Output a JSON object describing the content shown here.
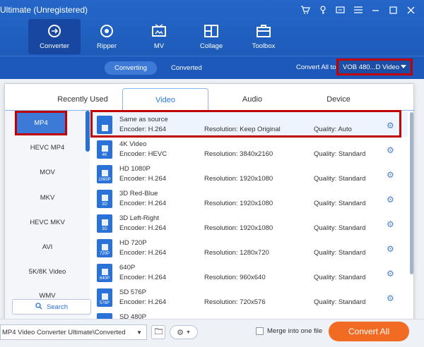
{
  "window": {
    "title": "Ultimate (Unregistered)"
  },
  "nav": [
    {
      "label": "Converter",
      "icon": "converter-icon"
    },
    {
      "label": "Ripper",
      "icon": "ripper-icon"
    },
    {
      "label": "MV",
      "icon": "mv-icon"
    },
    {
      "label": "Collage",
      "icon": "collage-icon"
    },
    {
      "label": "Toolbox",
      "icon": "toolbox-icon"
    }
  ],
  "subbar": {
    "converting": "Converting",
    "converted": "Converted",
    "convert_all_to": "Convert All to",
    "format_value": "VOB 480...D Video"
  },
  "panel": {
    "tabs": [
      "Recently Used",
      "Video",
      "Audio",
      "Device"
    ],
    "formats": [
      "MP4",
      "HEVC MP4",
      "MOV",
      "MKV",
      "HEVC MKV",
      "AVI",
      "5K/8K Video",
      "WMV"
    ],
    "search": "Search",
    "presets": [
      {
        "name": "Same as source",
        "encoder": "Encoder: H.264",
        "resolution": "Resolution: Keep Original",
        "quality": "Quality: Auto",
        "badge": ""
      },
      {
        "name": "4K Video",
        "encoder": "Encoder: HEVC",
        "resolution": "Resolution: 3840x2160",
        "quality": "Quality: Standard",
        "badge": "4K"
      },
      {
        "name": "HD 1080P",
        "encoder": "Encoder: H.264",
        "resolution": "Resolution: 1920x1080",
        "quality": "Quality: Standard",
        "badge": "1080P"
      },
      {
        "name": "3D Red-Blue",
        "encoder": "Encoder: H.264",
        "resolution": "Resolution: 1920x1080",
        "quality": "Quality: Standard",
        "badge": "3D"
      },
      {
        "name": "3D Left-Right",
        "encoder": "Encoder: H.264",
        "resolution": "Resolution: 1920x1080",
        "quality": "Quality: Standard",
        "badge": "3D"
      },
      {
        "name": "HD 720P",
        "encoder": "Encoder: H.264",
        "resolution": "Resolution: 1280x720",
        "quality": "Quality: Standard",
        "badge": "720P"
      },
      {
        "name": "640P",
        "encoder": "Encoder: H.264",
        "resolution": "Resolution: 960x640",
        "quality": "Quality: Standard",
        "badge": "640P"
      },
      {
        "name": "SD 576P",
        "encoder": "Encoder: H.264",
        "resolution": "Resolution: 720x576",
        "quality": "Quality: Standard",
        "badge": "576P"
      },
      {
        "name": "SD 480P",
        "encoder": "",
        "resolution": "",
        "quality": "",
        "badge": ""
      }
    ]
  },
  "bottom": {
    "path": "MP4 Video Converter Ultimate\\Converted",
    "merge_label": "Merge into one file",
    "convert_all": "Convert All"
  },
  "colors": {
    "header_blue": "#1e5dbf",
    "accent_blue": "#2a7ae2",
    "highlight_red": "#c00000",
    "convert_orange": "#f26b22"
  }
}
